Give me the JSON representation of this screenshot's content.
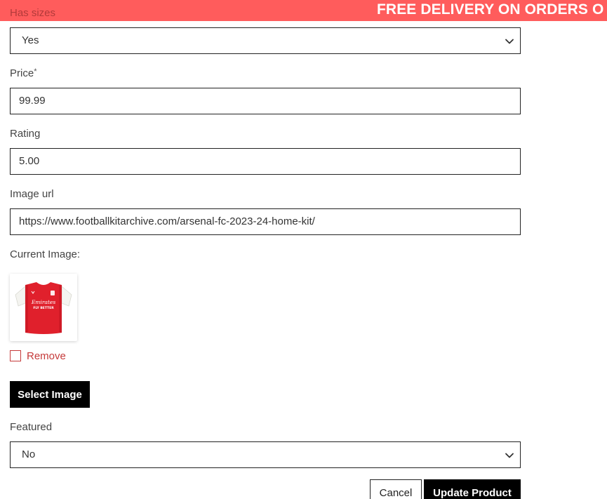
{
  "banner": {
    "message": "FREE DELIVERY ON ORDERS O",
    "color": "#ff5c5c"
  },
  "form": {
    "has_sizes": {
      "label": "Has sizes",
      "value": "Yes"
    },
    "price": {
      "label": "Price",
      "required_mark": "*",
      "value": "99.99"
    },
    "rating": {
      "label": "Rating",
      "value": "5.00"
    },
    "image_url": {
      "label": "Image url",
      "value": "https://www.footballkitarchive.com/arsenal-fc-2023-24-home-kit/"
    },
    "current_image": {
      "label": "Current Image:",
      "thumbnail_icon": "football-shirt-icon",
      "shirt_text_line1": "Emirates",
      "shirt_text_line2": "FLY BETTER"
    },
    "remove": {
      "label": "Remove",
      "checked": false
    },
    "select_image": {
      "label": "Select Image"
    },
    "featured": {
      "label": "Featured",
      "value": "No"
    }
  },
  "actions": {
    "cancel_label": "Cancel",
    "update_label": "Update Product"
  },
  "colors": {
    "accent": "#ff5c5c",
    "danger": "#c53a3a",
    "button_dark": "#000000"
  }
}
